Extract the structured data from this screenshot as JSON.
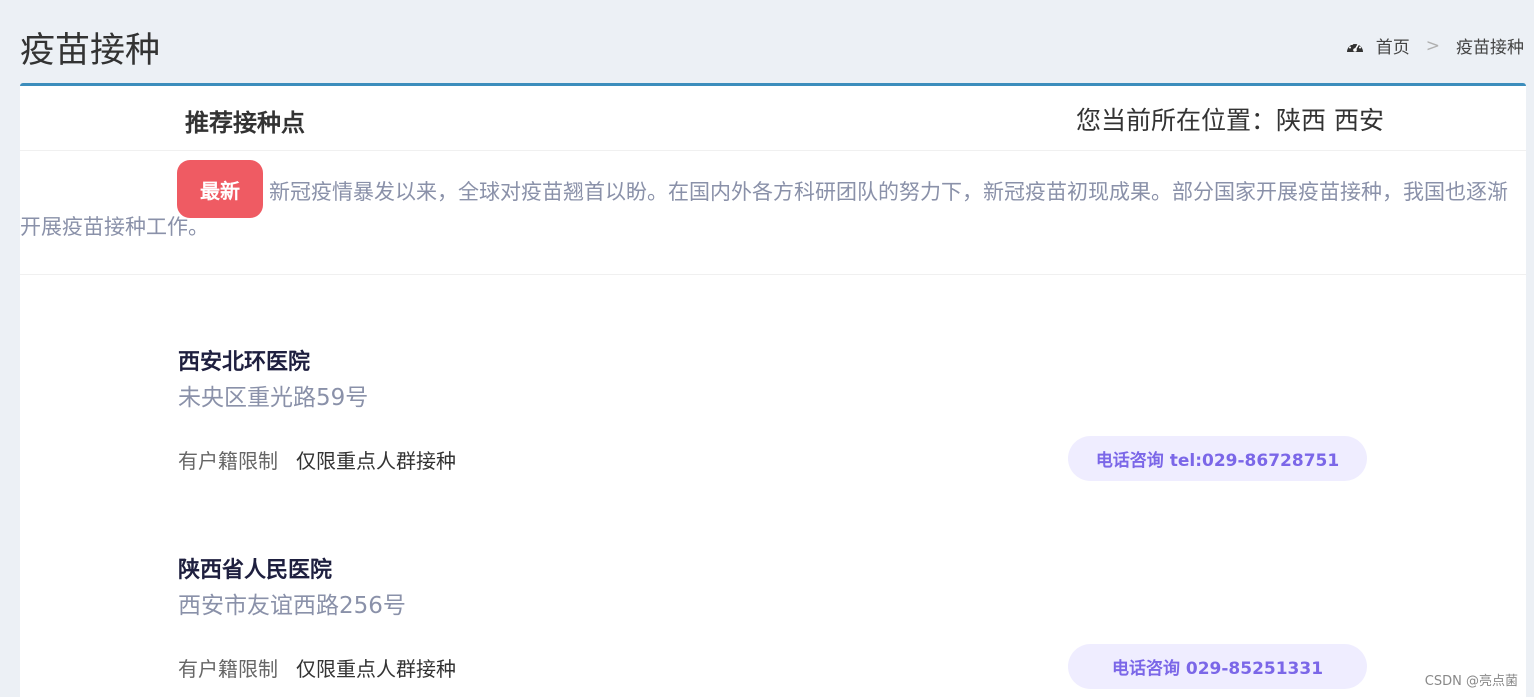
{
  "header": {
    "title": "疫苗接种",
    "breadcrumb": {
      "home": "首页",
      "sep": ">",
      "current": "疫苗接种"
    }
  },
  "box": {
    "title": "推荐接种点",
    "location": "您当前所在位置：陕西 西安"
  },
  "notice": {
    "badge": "最新",
    "text": "新冠疫情暴发以来，全球对疫苗翘首以盼。在国内外各方科研团队的努力下，新冠疫苗初现成果。部分国家开展疫苗接种，我国也逐渐开展疫苗接种工作。"
  },
  "sites": [
    {
      "name": "西安北环医院",
      "address": "未央区重光路59号",
      "restriction_label": "有户籍限制",
      "restriction_value": "仅限重点人群接种",
      "phone": "电话咨询 tel:029-86728751"
    },
    {
      "name": "陕西省人民医院",
      "address": "西安市友谊西路256号",
      "restriction_label": "有户籍限制",
      "restriction_value": "仅限重点人群接种",
      "phone": "电话咨询 029-85251331"
    }
  ],
  "watermark": "CSDN @亮点菌",
  "icons": {
    "home": "dashboard-icon"
  },
  "colors": {
    "accent": "#3c8dbc",
    "badge": "#ef5b63",
    "phone": "#7b67e8"
  }
}
